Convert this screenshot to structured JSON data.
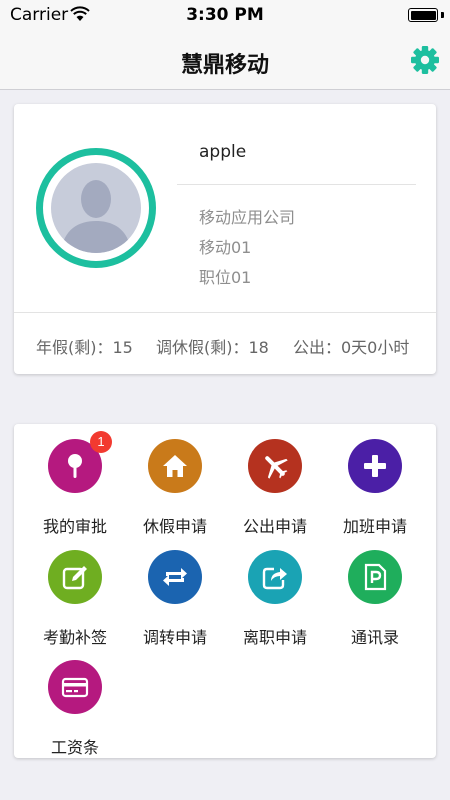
{
  "status": {
    "carrier": "Carrier",
    "time": "3:30 PM"
  },
  "nav": {
    "title": "慧鼎移动",
    "settings_icon": "gear-icon",
    "accent": "#1dbf9f"
  },
  "profile": {
    "name": "apple",
    "company": "移动应用公司",
    "department": "移动01",
    "position": "职位01",
    "stats": {
      "annual_leave": "年假(剩)：15",
      "comp_leave": "调休假(剩)：18",
      "business_trip": "公出：0天0小时"
    }
  },
  "apps": [
    {
      "label": "我的审批",
      "icon": "pin-icon",
      "color": "#b5197f",
      "badge": "1"
    },
    {
      "label": "休假申请",
      "icon": "home-icon",
      "color": "#c97a1a"
    },
    {
      "label": "公出申请",
      "icon": "airplane-icon",
      "color": "#b5321f"
    },
    {
      "label": "加班申请",
      "icon": "plus-icon",
      "color": "#4b1fa6"
    },
    {
      "label": "考勤补签",
      "icon": "edit-icon",
      "color": "#6fae21"
    },
    {
      "label": "调转申请",
      "icon": "transfer-icon",
      "color": "#1b64b0"
    },
    {
      "label": "离职申请",
      "icon": "share-icon",
      "color": "#1aa3b4"
    },
    {
      "label": "通讯录",
      "icon": "contacts-icon",
      "color": "#1fae5c"
    },
    {
      "label": "工资条",
      "icon": "payslip-icon",
      "color": "#b5197f"
    }
  ]
}
